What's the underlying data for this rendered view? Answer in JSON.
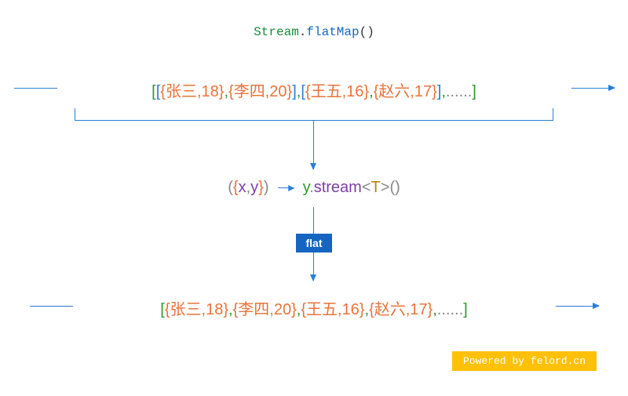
{
  "title": {
    "stream": "Stream",
    "dot": ".",
    "flatmap": "flatMap",
    "paren": "()"
  },
  "row1": {
    "outer_open": "[",
    "inner_open1": "[",
    "item1": "{张三,18}",
    "comma1": ",",
    "item2": "{李四,20}",
    "inner_close1": "]",
    "comma2": ",",
    "inner_open2": "[",
    "item3": "{王五,16}",
    "comma3": ",",
    "item4": "{赵六,17}",
    "inner_close2": "]",
    "comma4": ",",
    "ellipsis": "......",
    "outer_close": "]"
  },
  "lambda": {
    "paren_open": "(",
    "brace_open": "{",
    "x": "x",
    "comma": ",",
    "y": "y",
    "brace_close": "}",
    "paren_close": ")",
    "yvar": "y",
    "dot": ".",
    "stream": "stream",
    "lt": "<",
    "t": "T",
    "gt": ">",
    "call": "()"
  },
  "flat": {
    "label": "flat"
  },
  "row2": {
    "outer_open": "[",
    "item1": "{张三,18}",
    "comma1": ",",
    "item2": "{李四,20}",
    "comma2": ",",
    "item3": "{王五,16}",
    "comma3": ",",
    "item4": "{赵六,17}",
    "comma4": ",",
    "ellipsis": "......",
    "outer_close": "]"
  },
  "powered": {
    "text": "Powered by felord.cn"
  }
}
